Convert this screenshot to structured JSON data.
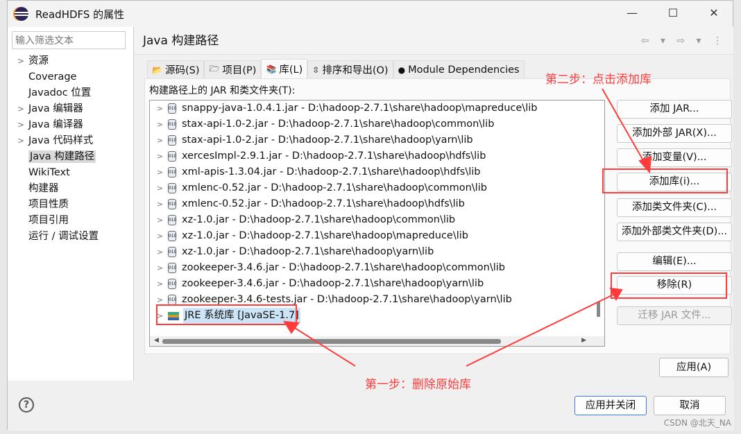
{
  "window": {
    "title": "ReadHDFS 的属性",
    "minimize": "—",
    "maximize": "☐",
    "close": "✕"
  },
  "sidebar": {
    "filter_placeholder": "输入筛选文本",
    "items": [
      {
        "label": "资源",
        "expandable": true
      },
      {
        "label": "Coverage"
      },
      {
        "label": "Javadoc 位置"
      },
      {
        "label": "Java 编辑器",
        "expandable": true
      },
      {
        "label": "Java 编译器",
        "expandable": true
      },
      {
        "label": "Java 代码样式",
        "expandable": true
      },
      {
        "label": "Java 构建路径",
        "selected": true
      },
      {
        "label": "WikiText"
      },
      {
        "label": "构建器"
      },
      {
        "label": "项目性质"
      },
      {
        "label": "项目引用"
      },
      {
        "label": "运行 / 调试设置"
      }
    ]
  },
  "page": {
    "title": "Java 构建路径",
    "nav": "⇦ ▾ ⇨ ▾ ⋮",
    "tabs": [
      {
        "label": "源码(S)",
        "icon": "📂"
      },
      {
        "label": "项目(P)",
        "icon": "🗁"
      },
      {
        "label": "库(L)",
        "icon": "📚",
        "active": true
      },
      {
        "label": "排序和导出(O)",
        "icon": "⇳"
      },
      {
        "label": "Module Dependencies",
        "icon": "●"
      }
    ],
    "list_label": "构建路径上的 JAR 和类文件夹(T):",
    "entries": [
      "snappy-java-1.0.4.1.jar  -  D:\\hadoop-2.7.1\\share\\hadoop\\mapreduce\\lib",
      "stax-api-1.0-2.jar  -  D:\\hadoop-2.7.1\\share\\hadoop\\common\\lib",
      "stax-api-1.0-2.jar  -  D:\\hadoop-2.7.1\\share\\hadoop\\yarn\\lib",
      "xercesImpl-2.9.1.jar  -  D:\\hadoop-2.7.1\\share\\hadoop\\hdfs\\lib",
      "xml-apis-1.3.04.jar  -  D:\\hadoop-2.7.1\\share\\hadoop\\hdfs\\lib",
      "xmlenc-0.52.jar  -  D:\\hadoop-2.7.1\\share\\hadoop\\common\\lib",
      "xmlenc-0.52.jar  -  D:\\hadoop-2.7.1\\share\\hadoop\\hdfs\\lib",
      "xz-1.0.jar  -  D:\\hadoop-2.7.1\\share\\hadoop\\common\\lib",
      "xz-1.0.jar  -  D:\\hadoop-2.7.1\\share\\hadoop\\mapreduce\\lib",
      "xz-1.0.jar  -  D:\\hadoop-2.7.1\\share\\hadoop\\yarn\\lib",
      "zookeeper-3.4.6.jar  -  D:\\hadoop-2.7.1\\share\\hadoop\\common\\lib",
      "zookeeper-3.4.6.jar  -  D:\\hadoop-2.7.1\\share\\hadoop\\yarn\\lib",
      "zookeeper-3.4.6-tests.jar  -  D:\\hadoop-2.7.1\\share\\hadoop\\yarn\\lib"
    ],
    "jre_entry": "JRE 系统库 [JavaSE-1.7]",
    "buttons": [
      {
        "label": "添加 JAR..."
      },
      {
        "label": "添加外部 JAR(X)..."
      },
      {
        "label": "添加变量(V)..."
      },
      {
        "label": "添加库(i)..."
      },
      {
        "label": "添加类文件夹(C)..."
      },
      {
        "label": "添加外部类文件夹(D)..."
      },
      {
        "label": "编辑(E)..."
      },
      {
        "label": "移除(R)"
      },
      {
        "label": "迁移 JAR 文件...",
        "disabled": true
      }
    ],
    "apply": "应用(A)"
  },
  "footer": {
    "help": "?",
    "apply_close": "应用并关闭",
    "cancel": "取消"
  },
  "annotations": {
    "step2": "第二步：点击添加库",
    "step1": "第一步：删除原始库",
    "color": "#ff3b3b"
  },
  "watermark": "CSDN @北天_NA"
}
